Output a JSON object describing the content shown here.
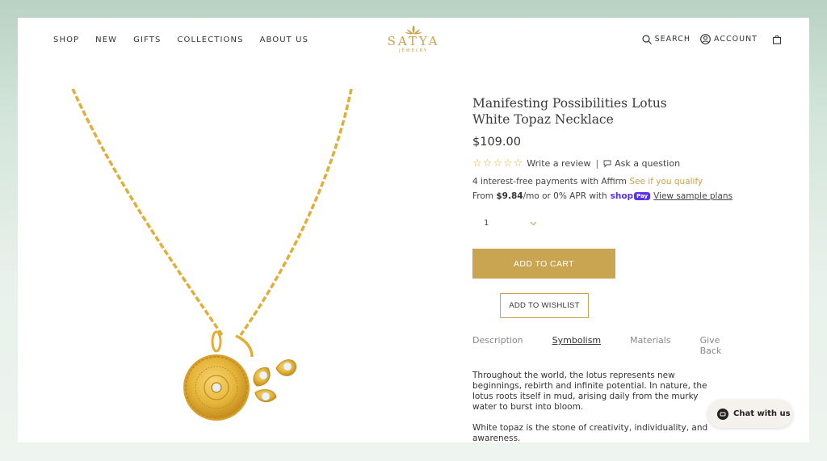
{
  "nav": {
    "items": [
      {
        "label": "SHOP"
      },
      {
        "label": "NEW"
      },
      {
        "label": "GIFTS"
      },
      {
        "label": "COLLECTIONS"
      },
      {
        "label": "ABOUT US"
      }
    ]
  },
  "logo": {
    "brand": "SATYA",
    "sub": "JEWELRY"
  },
  "utility": {
    "search": "SEARCH",
    "account": "ACCOUNT"
  },
  "product": {
    "title": "Manifesting Possibilities Lotus White Topaz Necklace",
    "price": "$109.00",
    "review_link": "Write a review",
    "separator": "|",
    "ask_question": "Ask a question",
    "rating_stars_filled": 0,
    "affirm_text": "4 interest-free payments with Affirm",
    "affirm_link": "See if you qualify",
    "shoppay_prefix": "From",
    "shoppay_amount": "$9.84",
    "shoppay_middle": "/mo or 0% APR with",
    "shoppay_brand": "shop",
    "shoppay_pay": "Pay",
    "shoppay_link": "View sample plans",
    "quantity": "1",
    "add_to_cart": "ADD TO CART",
    "add_to_wishlist": "ADD TO WISHLIST"
  },
  "tabs": [
    {
      "label": "Description"
    },
    {
      "label": "Symbolism"
    },
    {
      "label": "Materials"
    },
    {
      "label": "Give Back"
    }
  ],
  "description": {
    "p1": "Throughout the world, the lotus represents new beginnings, rebirth and infinite potential. In nature, the lotus roots itself in mud, arising daily from the murky water to burst into bloom.",
    "p2": "White topaz is the stone of creativity, individuality, and awareness."
  },
  "chat": {
    "label": "Chat with us"
  },
  "colors": {
    "gold": "#c9a451",
    "star": "#e4b23a",
    "shoppay": "#5a31f4"
  }
}
